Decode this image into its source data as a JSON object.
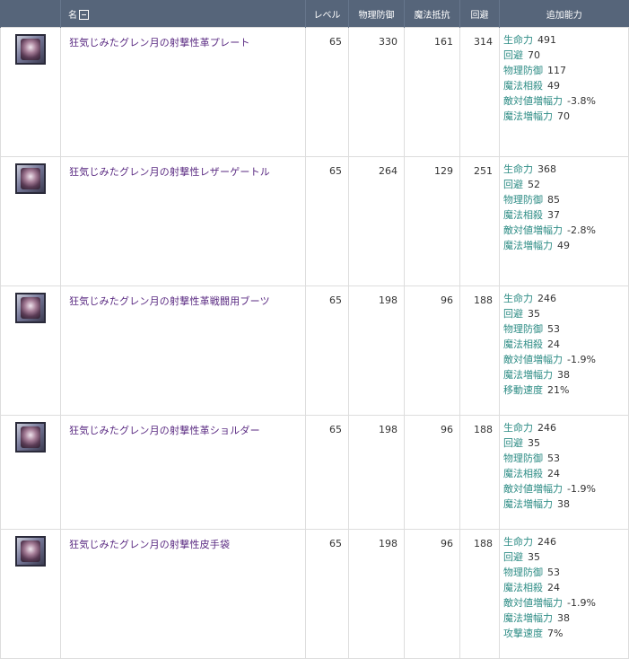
{
  "header": {
    "name": "名",
    "level": "レベル",
    "phys_def": "物理防御",
    "mag_res": "魔法抵抗",
    "evasion": "回避",
    "extra": "追加能力"
  },
  "colors": {
    "header_bg": "#56657a",
    "item_name": "#5a2a82",
    "stat_key": "#2d8c85"
  },
  "items": [
    {
      "icon": "plate-armor-icon",
      "name": "狂気じみたグレン月の射撃性革プレート",
      "level": "65",
      "phys_def": "330",
      "mag_res": "161",
      "evasion": "314",
      "stats": [
        {
          "key": "生命力",
          "value": "491"
        },
        {
          "key": "回避",
          "value": "70"
        },
        {
          "key": "物理防御",
          "value": "117"
        },
        {
          "key": "魔法相殺",
          "value": "49"
        },
        {
          "key": "敵対値増幅力",
          "value": "-3.8%"
        },
        {
          "key": "魔法増幅力",
          "value": "70"
        }
      ]
    },
    {
      "icon": "leg-armor-icon",
      "name": "狂気じみたグレン月の射撃性レザーゲートル",
      "level": "65",
      "phys_def": "264",
      "mag_res": "129",
      "evasion": "251",
      "stats": [
        {
          "key": "生命力",
          "value": "368"
        },
        {
          "key": "回避",
          "value": "52"
        },
        {
          "key": "物理防御",
          "value": "85"
        },
        {
          "key": "魔法相殺",
          "value": "37"
        },
        {
          "key": "敵対値増幅力",
          "value": "-2.8%"
        },
        {
          "key": "魔法増幅力",
          "value": "49"
        }
      ]
    },
    {
      "icon": "boots-icon",
      "name": "狂気じみたグレン月の射撃性革戦闘用ブーツ",
      "level": "65",
      "phys_def": "198",
      "mag_res": "96",
      "evasion": "188",
      "stats": [
        {
          "key": "生命力",
          "value": "246"
        },
        {
          "key": "回避",
          "value": "35"
        },
        {
          "key": "物理防御",
          "value": "53"
        },
        {
          "key": "魔法相殺",
          "value": "24"
        },
        {
          "key": "敵対値増幅力",
          "value": "-1.9%"
        },
        {
          "key": "魔法増幅力",
          "value": "38"
        },
        {
          "key": "移動速度",
          "value": "21%"
        }
      ]
    },
    {
      "icon": "shoulder-armor-icon",
      "name": "狂気じみたグレン月の射撃性革ショルダー",
      "level": "65",
      "phys_def": "198",
      "mag_res": "96",
      "evasion": "188",
      "stats": [
        {
          "key": "生命力",
          "value": "246"
        },
        {
          "key": "回避",
          "value": "35"
        },
        {
          "key": "物理防御",
          "value": "53"
        },
        {
          "key": "魔法相殺",
          "value": "24"
        },
        {
          "key": "敵対値増幅力",
          "value": "-1.9%"
        },
        {
          "key": "魔法増幅力",
          "value": "38"
        }
      ]
    },
    {
      "icon": "gloves-icon",
      "name": "狂気じみたグレン月の射撃性皮手袋",
      "level": "65",
      "phys_def": "198",
      "mag_res": "96",
      "evasion": "188",
      "stats": [
        {
          "key": "生命力",
          "value": "246"
        },
        {
          "key": "回避",
          "value": "35"
        },
        {
          "key": "物理防御",
          "value": "53"
        },
        {
          "key": "魔法相殺",
          "value": "24"
        },
        {
          "key": "敵対値増幅力",
          "value": "-1.9%"
        },
        {
          "key": "魔法増幅力",
          "value": "38"
        },
        {
          "key": "攻撃速度",
          "value": "7%"
        }
      ]
    }
  ]
}
